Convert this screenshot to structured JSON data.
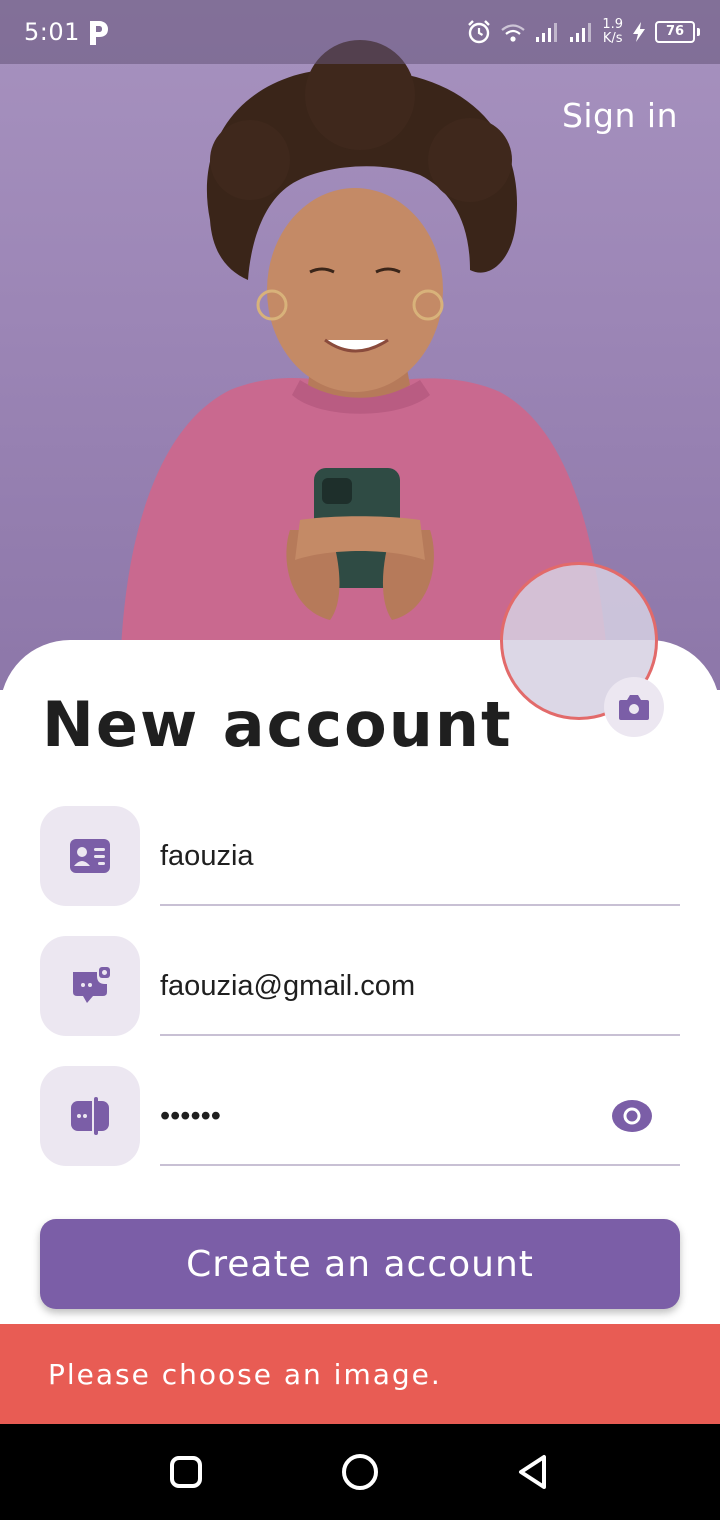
{
  "status_bar": {
    "time": "5:01",
    "app_icon": "parking-p-icon",
    "net_speed_value": "1.9",
    "net_speed_unit": "K/s",
    "battery_level": "76"
  },
  "header": {
    "sign_in_label": "Sign in"
  },
  "avatar": {
    "icon": "camera-icon"
  },
  "form": {
    "title": "New account",
    "name_value": "faouzia",
    "email_value": "faouzia@gmail.com",
    "password_value": "••••••",
    "name_icon": "contact-card-icon",
    "email_icon": "chat-bubble-icon",
    "password_icon": "lock-box-icon",
    "toggle_visibility_icon": "eye-icon"
  },
  "actions": {
    "create_account_label": "Create an account"
  },
  "snackbar": {
    "message": "Please choose an image."
  },
  "colors": {
    "primary": "#7b5ea7",
    "icon_bg": "#ece7f1",
    "error": "#e85c54",
    "avatar_ring": "#e26a6a"
  },
  "nav_bar": {
    "recents_icon": "square-icon",
    "home_icon": "circle-icon",
    "back_icon": "triangle-back-icon"
  }
}
